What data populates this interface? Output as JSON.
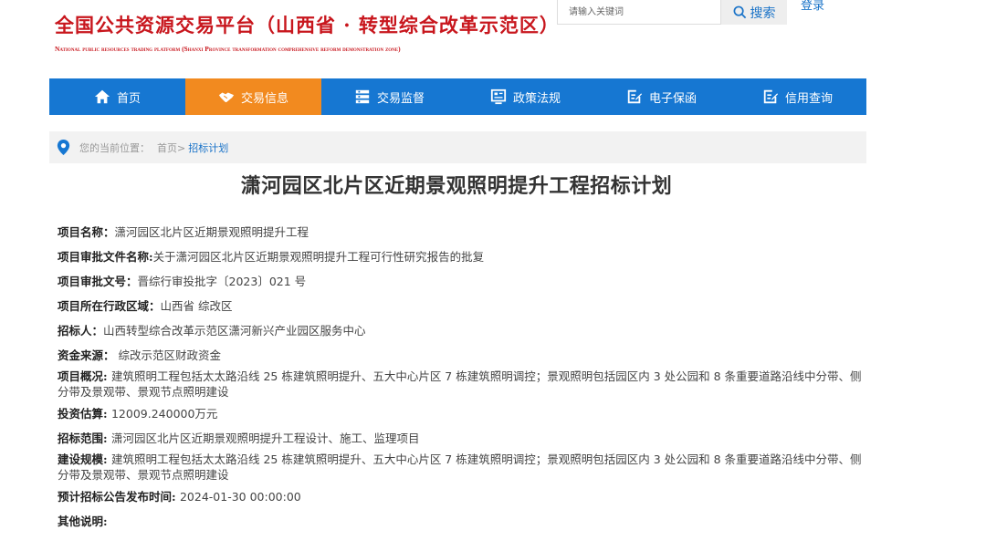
{
  "header": {
    "title": "全国公共资源交易平台（山西省 · 转型综合改革示范区）",
    "subtitle": "National public resources trading platform (Shanxi Province transformation comprehensive reform demonstration zone)",
    "search_placeholder": "请输入关键词",
    "search_label": "搜索",
    "login_label": "登录"
  },
  "nav": {
    "items": [
      {
        "label": "首页",
        "icon": "home-icon"
      },
      {
        "label": "交易信息",
        "icon": "handshake-icon"
      },
      {
        "label": "交易监督",
        "icon": "monitor-icon"
      },
      {
        "label": "政策法规",
        "icon": "document-icon"
      },
      {
        "label": "电子保函",
        "icon": "edit-icon"
      },
      {
        "label": "信用查询",
        "icon": "edit-icon"
      }
    ],
    "active_index": 1,
    "color": "#1677d2",
    "active_color": "#f28a1f"
  },
  "breadcrumb": {
    "prefix": "您的当前位置：",
    "home": "首页>",
    "current": "招标计划"
  },
  "article": {
    "title": "潇河园区北片区近期景观照明提升工程招标计划",
    "fields": [
      {
        "label": "项目名称：",
        "value": "潇河园区北片区近期景观照明提升工程"
      },
      {
        "label": "项目审批文件名称:",
        "value": "关于潇河园区北片区近期景观照明提升工程可行性研究报告的批复"
      },
      {
        "label": "项目审批文号：",
        "value": "晋综行审投批字〔2023〕021 号"
      },
      {
        "label": "项目所在行政区域：",
        "value": "山西省 综改区"
      },
      {
        "label": "招标人：",
        "value": "山西转型综合改革示范区潇河新兴产业园区服务中心"
      },
      {
        "label": "资金来源：",
        "value": " 综改示范区财政资金"
      },
      {
        "label": "项目概况: ",
        "value": "建筑照明工程包括太太路沿线 25 栋建筑照明提升、五大中心片区 7 栋建筑照明调控；景观照明包括园区内 3 处公园和 8 条重要道路沿线中分带、侧分带及景观带、景观节点照明建设"
      },
      {
        "label": "投资估算: ",
        "value": "12009.240000万元"
      },
      {
        "label": "招标范围: ",
        "value": "潇河园区北片区近期景观照明提升工程设计、施工、监理项目"
      },
      {
        "label": "建设规模: ",
        "value": "建筑照明工程包括太太路沿线 25 栋建筑照明提升、五大中心片区 7 栋建筑照明调控；景观照明包括园区内 3 处公园和 8 条重要道路沿线中分带、侧分带及景观带、景观节点照明建设"
      },
      {
        "label": "预计招标公告发布时间: ",
        "value": "2024-01-30 00:00:00"
      },
      {
        "label": "其他说明: ",
        "value": ""
      }
    ]
  }
}
